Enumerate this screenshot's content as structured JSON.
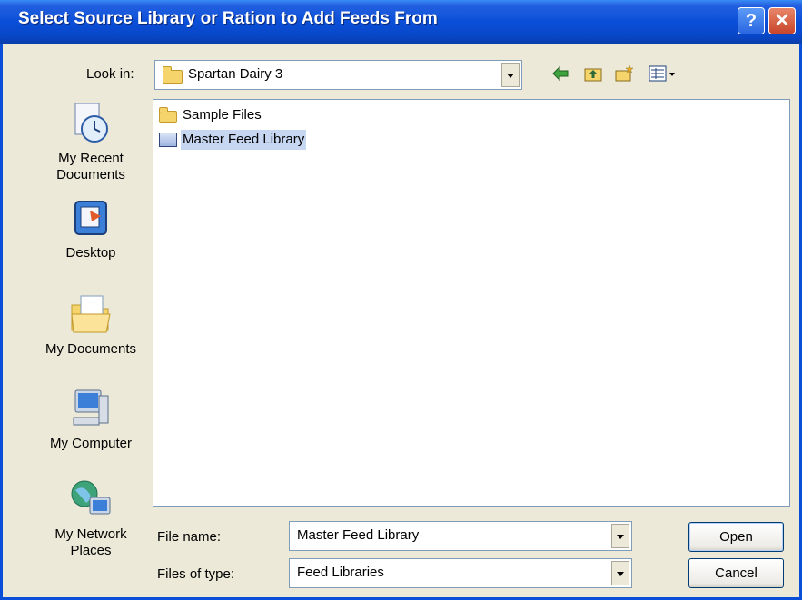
{
  "window": {
    "title": "Select Source Library or Ration to Add Feeds From",
    "help_symbol": "?",
    "close_symbol": "✕"
  },
  "look_in": {
    "label": "Look in:",
    "value": "Spartan Dairy 3"
  },
  "toolbar": {
    "back_icon": "back-arrow-icon",
    "up_icon": "up-one-level-icon",
    "new_folder_icon": "new-folder-icon",
    "views_icon": "views-menu-icon"
  },
  "places": [
    {
      "label": "My Recent\nDocuments",
      "icon": "recent-documents-icon"
    },
    {
      "label": "Desktop",
      "icon": "desktop-icon"
    },
    {
      "label": "My Documents",
      "icon": "my-documents-icon"
    },
    {
      "label": "My Computer",
      "icon": "my-computer-icon"
    },
    {
      "label": "My Network\nPlaces",
      "icon": "network-places-icon"
    }
  ],
  "files": [
    {
      "name": "Sample Files",
      "type": "folder",
      "selected": false
    },
    {
      "name": "Master Feed Library",
      "type": "library",
      "selected": true
    }
  ],
  "file_name": {
    "label": "File name:",
    "value": "Master Feed Library"
  },
  "file_type": {
    "label": "Files of type:",
    "value": "Feed Libraries"
  },
  "buttons": {
    "open": "Open",
    "cancel": "Cancel"
  },
  "colors": {
    "titlebar": "#0A4FD8",
    "dialog_bg": "#ECE9D8",
    "selection": "#C7D7F2"
  }
}
